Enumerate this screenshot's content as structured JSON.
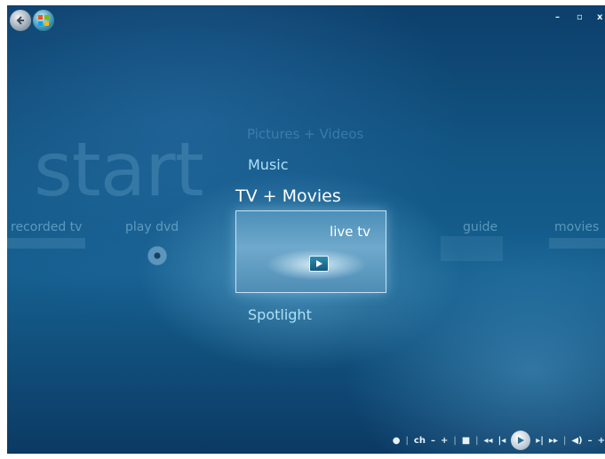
{
  "window": {
    "minimize_glyph": "–",
    "restore_glyph": "▫",
    "close_glyph": "x"
  },
  "nav": {
    "back_icon": "back-arrow-icon",
    "start_icon": "windows-orb-icon"
  },
  "background_title": "start",
  "menu": {
    "pictures": "Pictures + Videos",
    "music": "Music",
    "tv_movies": "TV + Movies",
    "spotlight": "Spotlight"
  },
  "strip": {
    "recorded_tv": "recorded tv",
    "play_dvd": "play dvd",
    "live_tv": "live tv",
    "guide": "guide",
    "movies": "movies"
  },
  "transport": {
    "dot": "●",
    "ch": "ch",
    "ch_minus": "–",
    "ch_plus": "+",
    "stop": "■",
    "rewind": "◂◂",
    "prev": "|◂",
    "next": "▸|",
    "fast_forward": "▸▸",
    "mute": "◀)",
    "vol_minus": "–",
    "vol_plus": "+"
  },
  "colors": {
    "accent": "#aee0f5",
    "background": "#125684"
  }
}
